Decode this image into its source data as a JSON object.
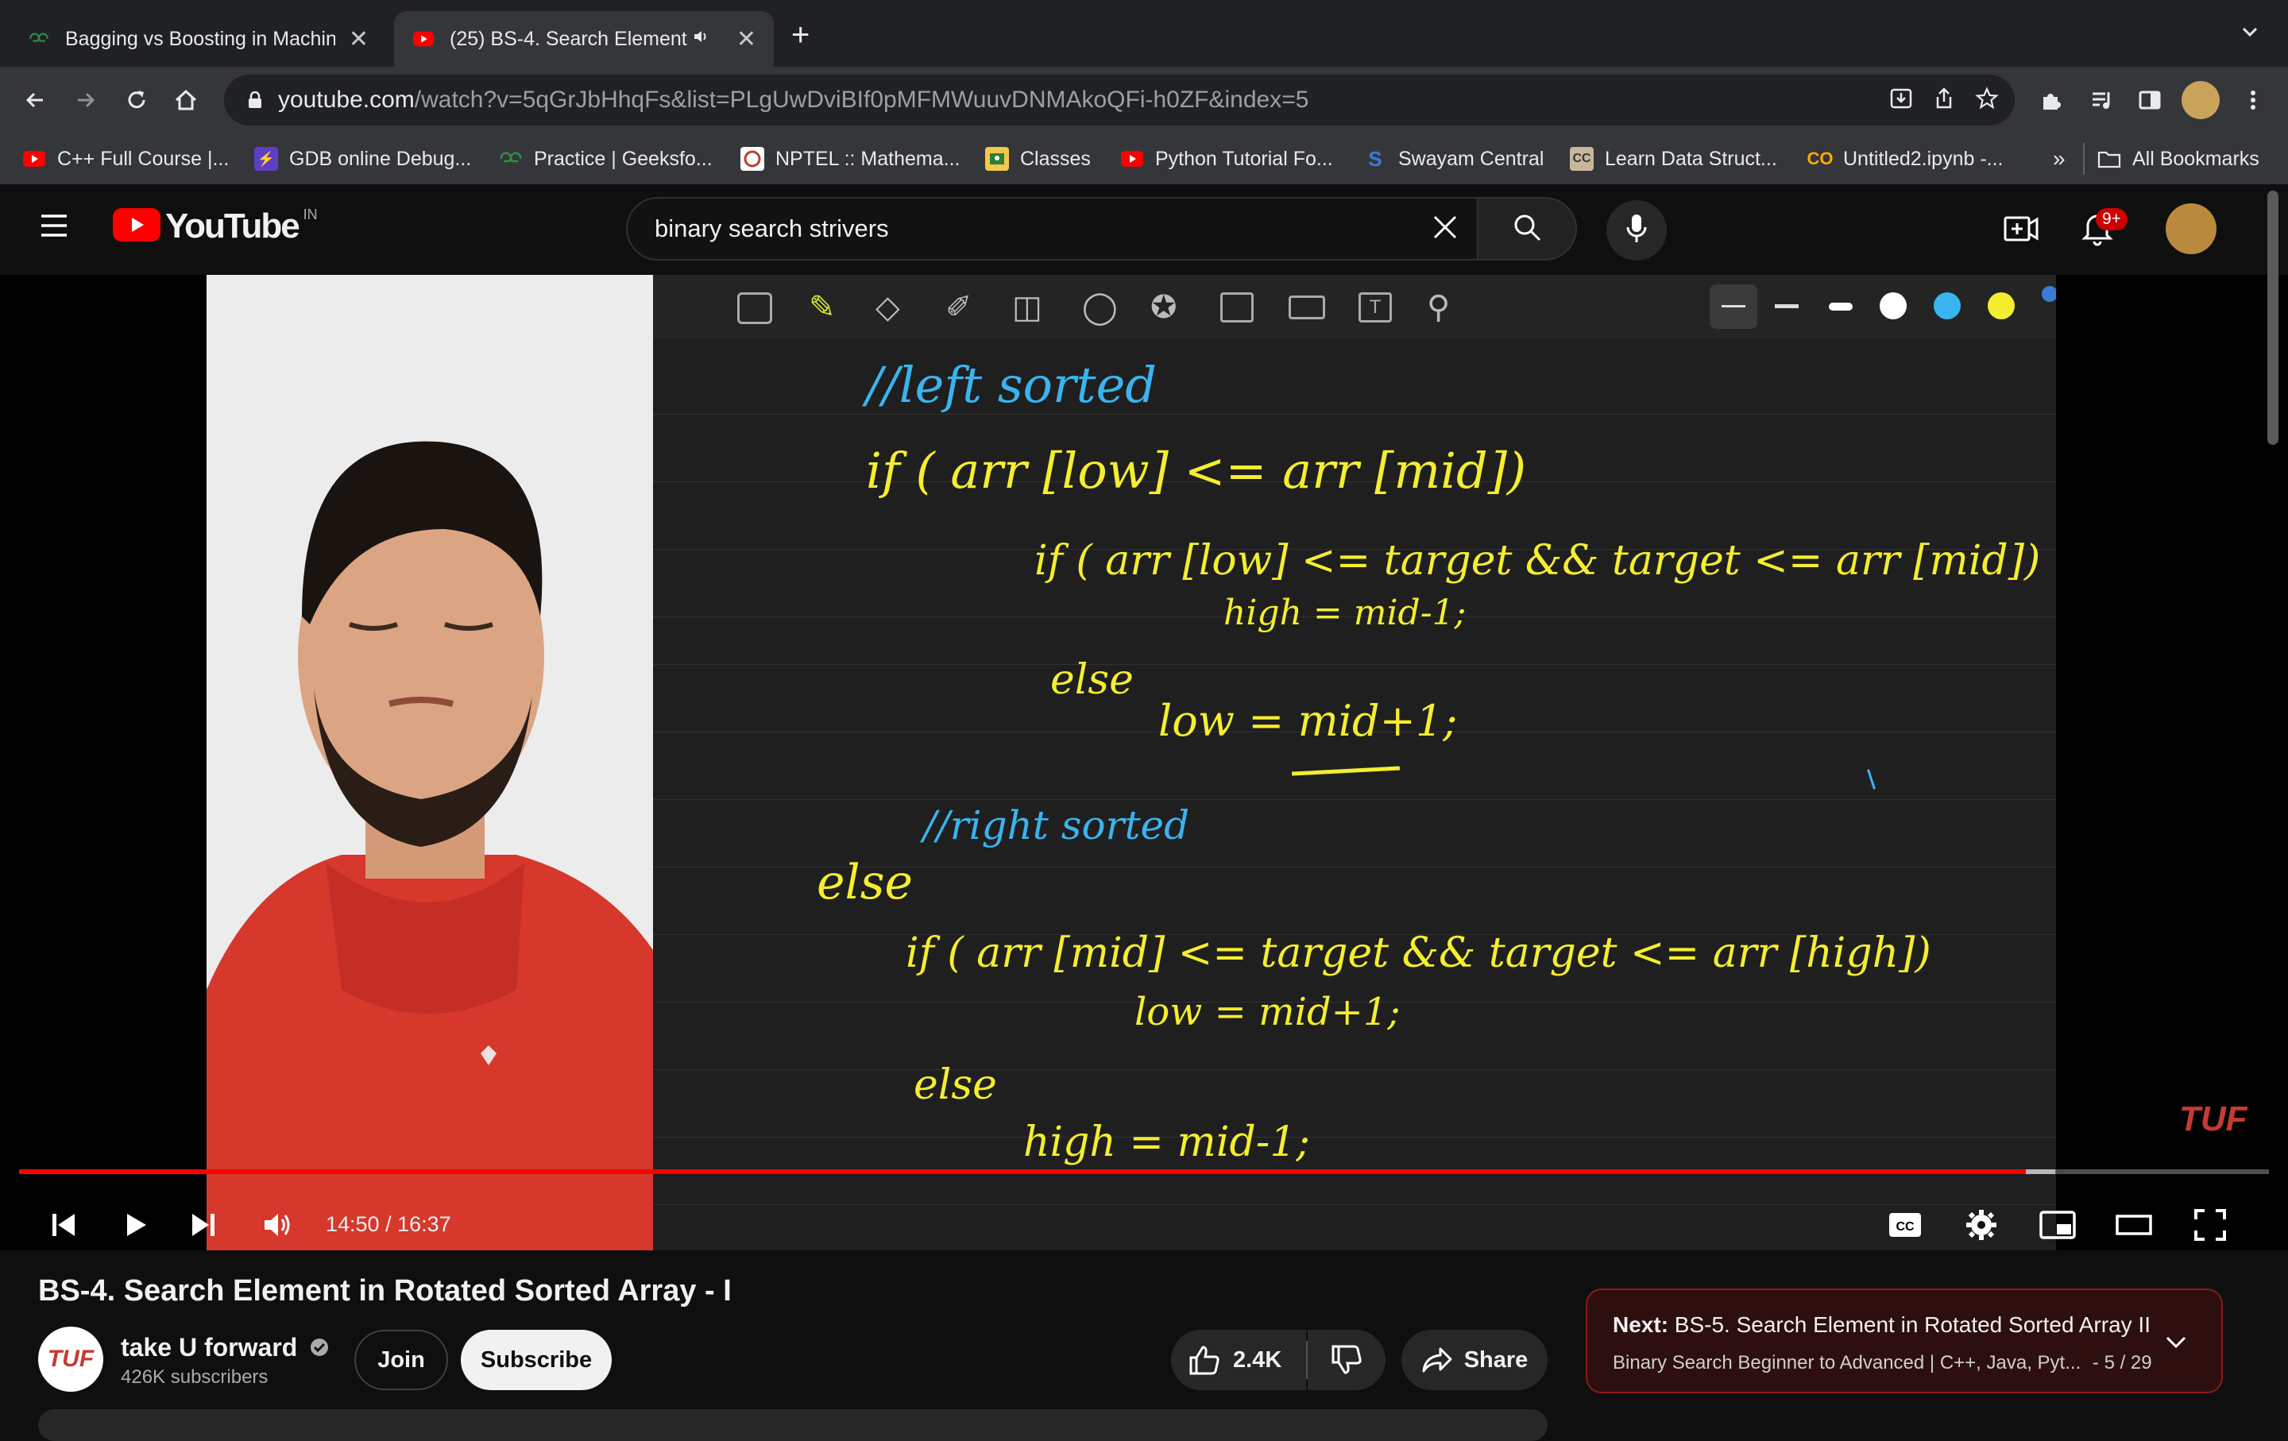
{
  "browser": {
    "tabs": [
      {
        "title": "Bagging vs Boosting in Machin",
        "icon": "geeksforgeeks-icon"
      },
      {
        "title": "(25) BS-4. Search Element",
        "icon": "youtube-icon",
        "audio": true
      }
    ],
    "new_tab": "+",
    "url_host": "youtube.com",
    "url_path": "/watch?v=5qGrJbHhqFs&list=PLgUwDviBIf0pMFMWuuvDNMAkoQFi-h0ZF&index=5",
    "bookmarks": [
      {
        "label": "C++ Full Course |...",
        "icon": "youtube-icon"
      },
      {
        "label": "GDB online Debug...",
        "icon": "bolt-icon"
      },
      {
        "label": "Practice | Geeksfo...",
        "icon": "geeksforgeeks-icon"
      },
      {
        "label": "NPTEL :: Mathema...",
        "icon": "nptel-icon"
      },
      {
        "label": "Classes",
        "icon": "classroom-icon"
      },
      {
        "label": "Python Tutorial Fo...",
        "icon": "youtube-icon"
      },
      {
        "label": "Swayam Central",
        "icon": "swayam-icon"
      },
      {
        "label": "Learn Data Struct...",
        "icon": "cc-icon"
      },
      {
        "label": "Untitled2.ipynb -...",
        "icon": "colab-icon"
      }
    ],
    "bookmarks_overflow": "»",
    "all_bookmarks": "All Bookmarks"
  },
  "youtube": {
    "logo_text": "YouTube",
    "country": "IN",
    "search_value": "binary search strivers",
    "notifications_badge": "9+"
  },
  "video": {
    "time_current": "14:50",
    "time_sep": " / ",
    "time_total": "16:37",
    "progress_played": 0.892,
    "progress_loaded": 0.905,
    "watermark": "TUF",
    "board_lines": [
      {
        "text": "//left sorted",
        "color": "blue"
      },
      {
        "text": "if ( arr [low] <=   arr [mid])",
        "color": "yellow"
      },
      {
        "text": "if ( arr [low] <= target && target <= arr [mid])",
        "color": "yellow"
      },
      {
        "text": "high = mid-1;",
        "color": "yellow"
      },
      {
        "text": "else",
        "color": "yellow"
      },
      {
        "text": "low = mid+1;",
        "color": "yellow"
      },
      {
        "text": "//right sorted",
        "color": "blue"
      },
      {
        "text": "else",
        "color": "yellow"
      },
      {
        "text": "if ( arr [mid] <= target && target <= arr [high])",
        "color": "yellow"
      },
      {
        "text": "low = mid+1;",
        "color": "yellow"
      },
      {
        "text": "else",
        "color": "yellow"
      },
      {
        "text": "high = mid-1;",
        "color": "yellow"
      }
    ]
  },
  "info": {
    "title": "BS-4. Search Element in Rotated Sorted Array - I",
    "channel": "take U forward",
    "avatar_text": "TUF",
    "subscribers": "426K subscribers",
    "join": "Join",
    "subscribe": "Subscribe",
    "likes": "2.4K",
    "share": "Share"
  },
  "next": {
    "prefix": "Next:",
    "title": "BS-5. Search Element in Rotated Sorted Array II",
    "playlist": "Binary Search Beginner to Advanced | C++, Java, Pyt...",
    "position": "- 5 / 29"
  },
  "colors": {
    "accent": "#ff0000",
    "chalk_blue": "#3ab4ef",
    "chalk_yellow": "#f4ee2f",
    "tuf_red": "#c63a33"
  }
}
